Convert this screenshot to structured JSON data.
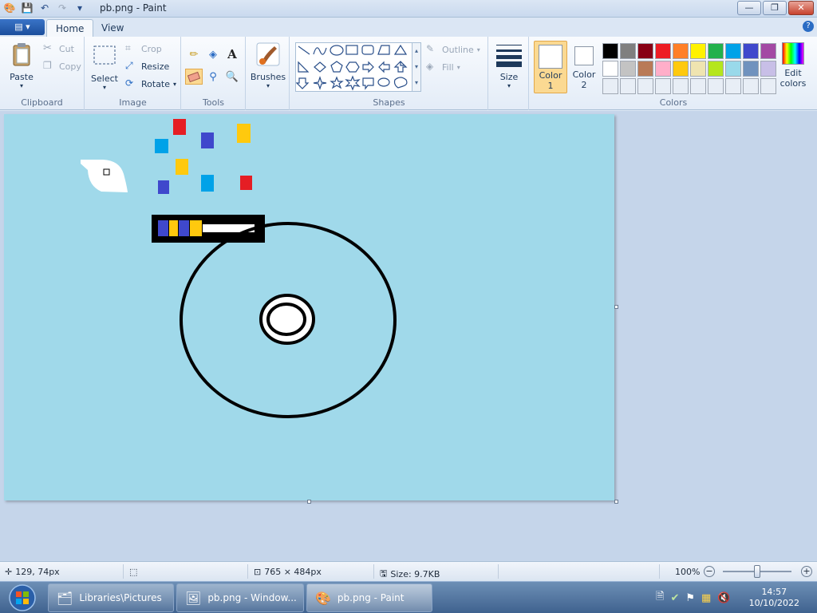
{
  "window": {
    "title": "pb.png - Paint"
  },
  "tabs": [
    {
      "label": "Home"
    },
    {
      "label": "View"
    }
  ],
  "clipboard": {
    "paste": "Paste",
    "cut": "Cut",
    "copy": "Copy",
    "label": "Clipboard"
  },
  "image": {
    "select": "Select",
    "crop": "Crop",
    "resize": "Resize",
    "rotate": "Rotate",
    "label": "Image"
  },
  "tools": {
    "label": "Tools",
    "text_tool": "A"
  },
  "brushes": {
    "label": "Brushes"
  },
  "shapes": {
    "outline": "Outline",
    "fill": "Fill",
    "label": "Shapes"
  },
  "size": {
    "label": "Size"
  },
  "colors": {
    "color1_label": "Color",
    "color1_num": "1",
    "color2_label": "Color",
    "color2_num": "2",
    "edit_label_1": "Edit",
    "edit_label_2": "colors",
    "label": "Colors",
    "color1_value": "#ffffff",
    "color2_value": "#ffffff",
    "palette": [
      "#000000",
      "#7f7f7f",
      "#880015",
      "#ed1c24",
      "#ff7f27",
      "#fff200",
      "#22b14c",
      "#00a2e8",
      "#3f48cc",
      "#a349a4",
      "#ffffff",
      "#c3c3c3",
      "#b97a57",
      "#ffaec9",
      "#ffc90e",
      "#efe4b0",
      "#b5e61d",
      "#99d9ea",
      "#7092be",
      "#c8bfe7",
      "#e8eef6",
      "#e8eef6",
      "#e8eef6",
      "#e8eef6",
      "#e8eef6",
      "#e8eef6",
      "#e8eef6",
      "#e8eef6",
      "#e8eef6",
      "#e8eef6"
    ]
  },
  "canvas": {
    "background": "#a0d9ea"
  },
  "status": {
    "cursor_pos": "129, 74px",
    "image_size": "765 × 484px",
    "file_size": "Size: 9.7KB",
    "zoom": "100%"
  },
  "taskbar": {
    "items": [
      {
        "label": "Libraries\\Pictures"
      },
      {
        "label": "pb.png - Window..."
      },
      {
        "label": "pb.png - Paint"
      }
    ],
    "time": "14:57",
    "date": "10/10/2022"
  }
}
